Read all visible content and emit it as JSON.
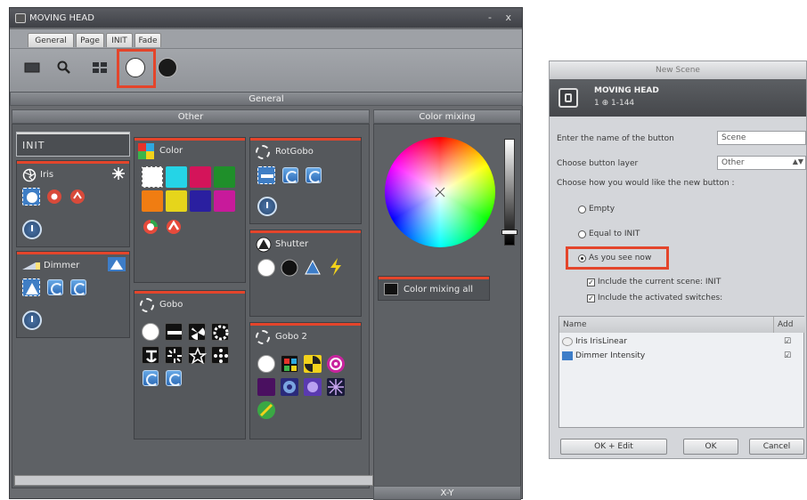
{
  "main_window": {
    "title": "MOVING HEAD",
    "window_controls": "- x",
    "tabs": [
      "General",
      "Page",
      "INIT",
      "Fade"
    ],
    "section_general": "General",
    "section_other": "Other",
    "section_color_mixing": "Color mixing",
    "section_xy": "X-Y",
    "preset_init": "INIT",
    "groups": {
      "iris": "Iris",
      "dimmer": "Dimmer",
      "color": "Color",
      "gobo": "Gobo",
      "rotgobo": "RotGobo",
      "shutter": "Shutter",
      "gobo2": "Gobo 2"
    },
    "color_mixing_all": "Color mixing all",
    "color_swatches": [
      "#ffffff",
      "#25d4e6",
      "#d4145a",
      "#1f8f2a",
      "#f07d12",
      "#e6d51b",
      "#2a1fa0",
      "#c81a9b"
    ],
    "highlight_color": "#e4452b"
  },
  "dialog": {
    "title": "New Scene",
    "fixture_name": "MOVING HEAD",
    "fixture_info": "1 ⊕ 1-144",
    "label_name": "Enter the name of the button",
    "value_name": "Scene",
    "label_layer": "Choose button layer",
    "value_layer": "Other",
    "label_how": "Choose how you would like the new button :",
    "radio_empty": "Empty",
    "radio_equal_init": "Equal to INIT",
    "radio_as_you_see": "As you see now",
    "check_include_scene": "Include the current scene: INIT",
    "check_include_switches": "Include the activated switches:",
    "table_headers": [
      "Name",
      "Add"
    ],
    "table_rows": [
      {
        "name": "Iris IrisLinear",
        "add": "☑"
      },
      {
        "name": "Dimmer Intensity",
        "add": "☑"
      }
    ],
    "btn_ok_edit": "OK + Edit",
    "btn_ok": "OK",
    "btn_cancel": "Cancel"
  }
}
